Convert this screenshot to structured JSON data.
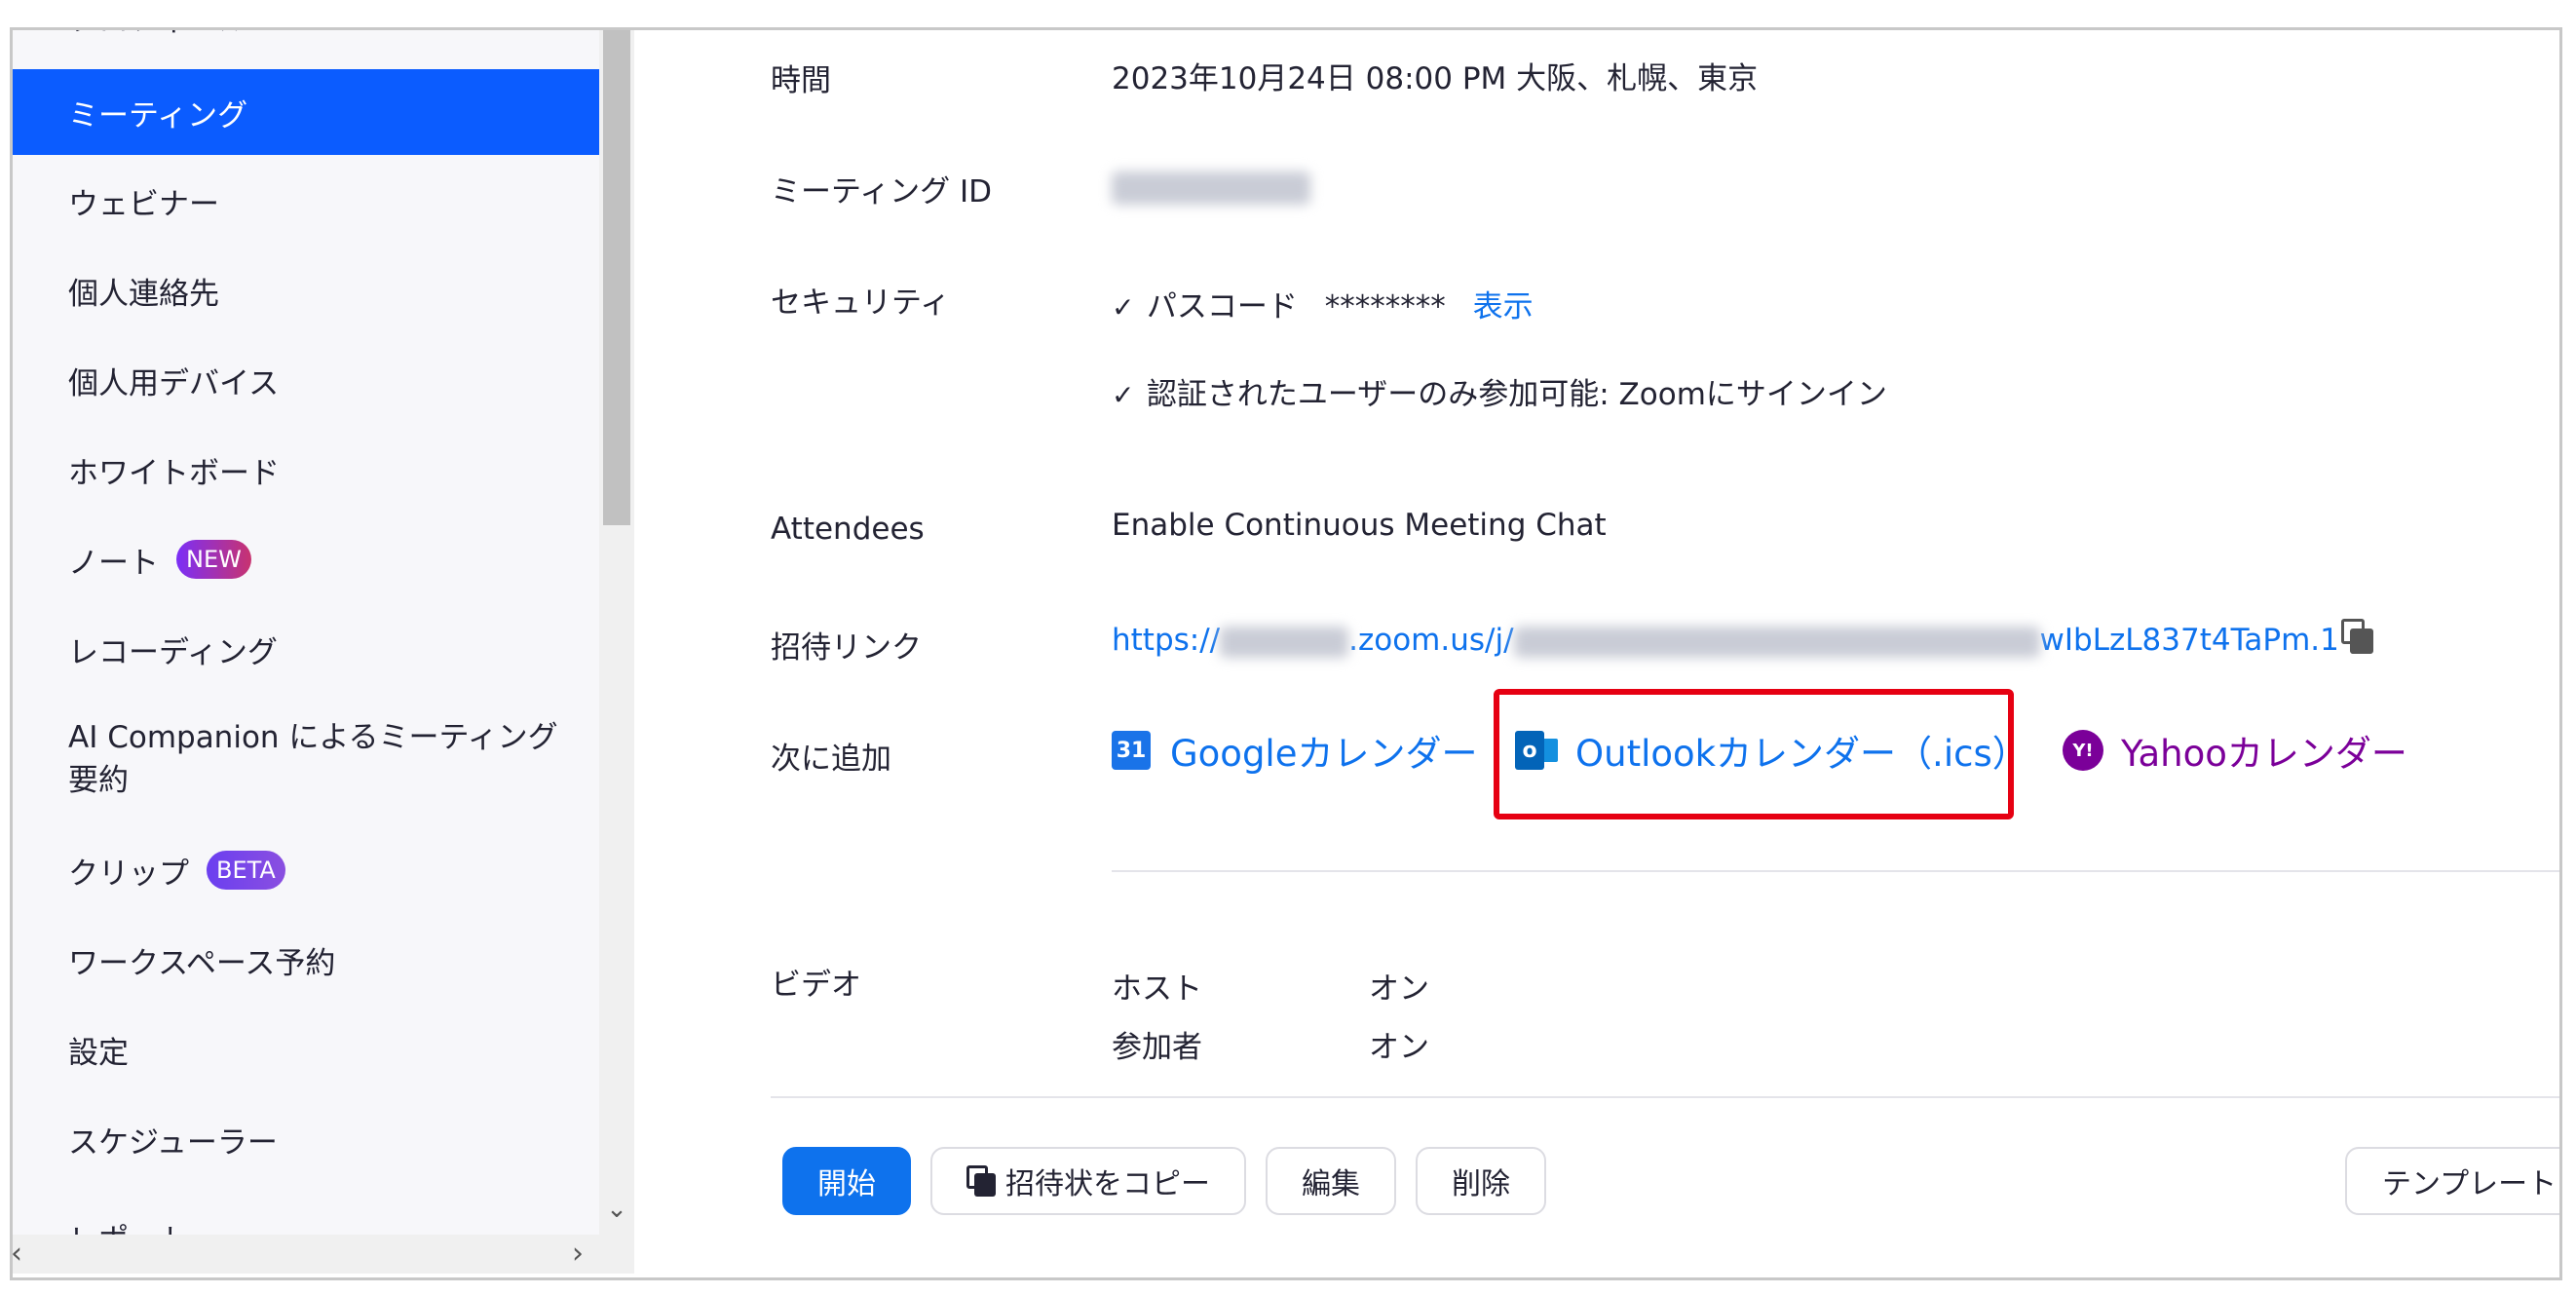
{
  "sidebar": {
    "items": [
      {
        "label": "プロフィール"
      },
      {
        "label": "ミーティング"
      },
      {
        "label": "ウェビナー"
      },
      {
        "label": "個人連絡先"
      },
      {
        "label": "個人用デバイス"
      },
      {
        "label": "ホワイトボード"
      },
      {
        "label": "ノート",
        "badge": "NEW"
      },
      {
        "label": "レコーディング"
      },
      {
        "label": "AI Companion によるミーティング要約"
      },
      {
        "label": "クリップ",
        "badge": "BETA"
      },
      {
        "label": "ワークスペース予約"
      },
      {
        "label": "設定"
      },
      {
        "label": "スケジューラー"
      },
      {
        "label": "レポート"
      }
    ]
  },
  "details": {
    "time": {
      "label": "時間",
      "value": "2023年10月24日 08:00 PM 大阪、札幌、東京"
    },
    "meeting_id": {
      "label": "ミーティング ID"
    },
    "security": {
      "label": "セキュリティ",
      "passcode_label": "パスコード",
      "passcode_mask": "********",
      "show_link": "表示",
      "auth_text": "認証されたユーザーのみ参加可能: Zoomにサインイン"
    },
    "attendees": {
      "label": "Attendees",
      "value": "Enable Continuous Meeting Chat"
    },
    "invite_link": {
      "label": "招待リンク",
      "prefix": "https://",
      "middle": ".zoom.us/j/",
      "suffix": "wIbLzL837t4TaPm.1"
    },
    "add_to": {
      "label": "次に追加",
      "google": "Googleカレンダー",
      "outlook": "Outlookカレンダー（.ics）",
      "yahoo": "Yahooカレンダー"
    },
    "video": {
      "label": "ビデオ",
      "host_label": "ホスト",
      "host_value": "オン",
      "participant_label": "参加者",
      "participant_value": "オン"
    }
  },
  "actions": {
    "start": "開始",
    "copy_invite": "招待状をコピー",
    "edit": "編集",
    "delete": "削除",
    "template": "テンプレート"
  },
  "colors": {
    "accent": "#0b5cff",
    "link": "#0e72ed",
    "highlight": "#e60012",
    "yahoo": "#7b0099"
  }
}
